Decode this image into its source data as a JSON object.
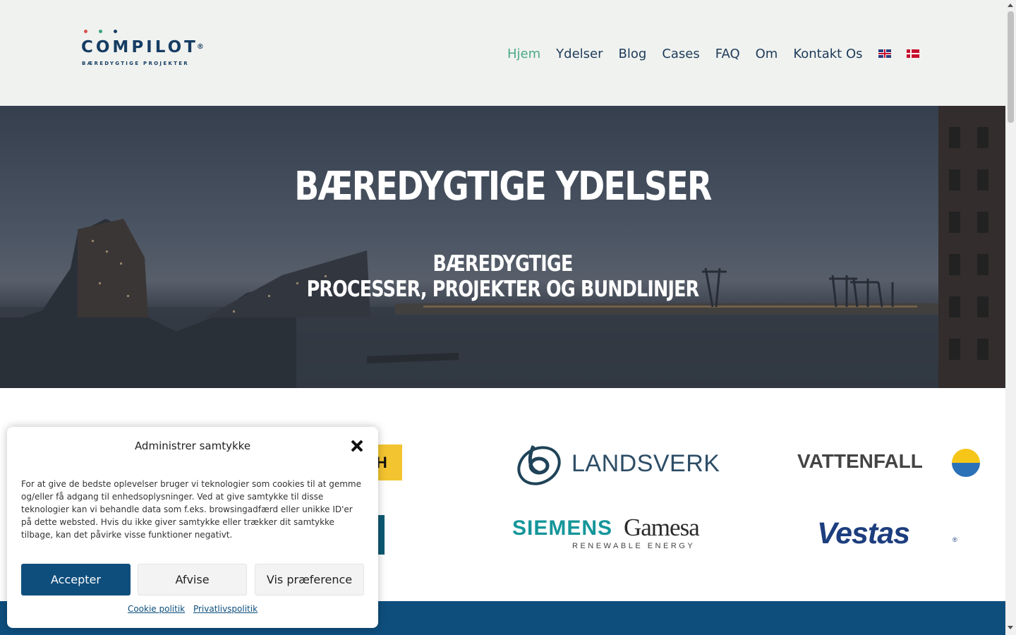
{
  "logo": {
    "word": "COMPILOT",
    "reg": "®",
    "tagline": "BÆREDYGTIGE PROJEKTER",
    "dot_colors": [
      "#d9534f",
      "#3aa37f",
      "#163d63"
    ]
  },
  "nav": {
    "items": [
      {
        "label": "Hjem",
        "active": true
      },
      {
        "label": "Ydelser"
      },
      {
        "label": "Blog"
      },
      {
        "label": "Cases"
      },
      {
        "label": "FAQ"
      },
      {
        "label": "Om"
      },
      {
        "label": "Kontakt Os"
      }
    ],
    "flags": [
      "uk-flag",
      "dk-flag"
    ]
  },
  "hero": {
    "title": "BÆREDYGTIGE YDELSER",
    "subtitle_line1": "BÆREDYGTIGE",
    "subtitle_line2": "PROCESSER, PROJEKTER OG BUNDLINJER"
  },
  "partners": {
    "landsverk": "LANDSVERK",
    "vattenfall": "VATTENFALL",
    "siemens": "SIEMENS",
    "gamesa": "Gamesa",
    "gamesa_sub": "RENEWABLE ENERGY",
    "vestas": "Vestas",
    "vestas_reg": "®",
    "partial_left": "CH"
  },
  "consent": {
    "title": "Administrer samtykke",
    "body": "For at give de bedste oplevelser bruger vi teknologier som cookies til at gemme og/eller få adgang til enhedsoplysninger. Ved at give samtykke til disse teknologier kan vi behandle data som f.eks. browsingadfærd eller unikke ID'er på dette websted. Hvis du ikke giver samtykke eller trækker dit samtykke tilbage, kan det påvirke visse funktioner negativt.",
    "accept": "Accepter",
    "deny": "Afvise",
    "preferences": "Vis præference",
    "cookie_policy": "Cookie politik",
    "privacy_policy": "Privatlivspolitik"
  },
  "colors": {
    "brand_blue": "#0e4e7d",
    "nav_active": "#4aa88a",
    "header_bg": "#f0f2ef"
  }
}
